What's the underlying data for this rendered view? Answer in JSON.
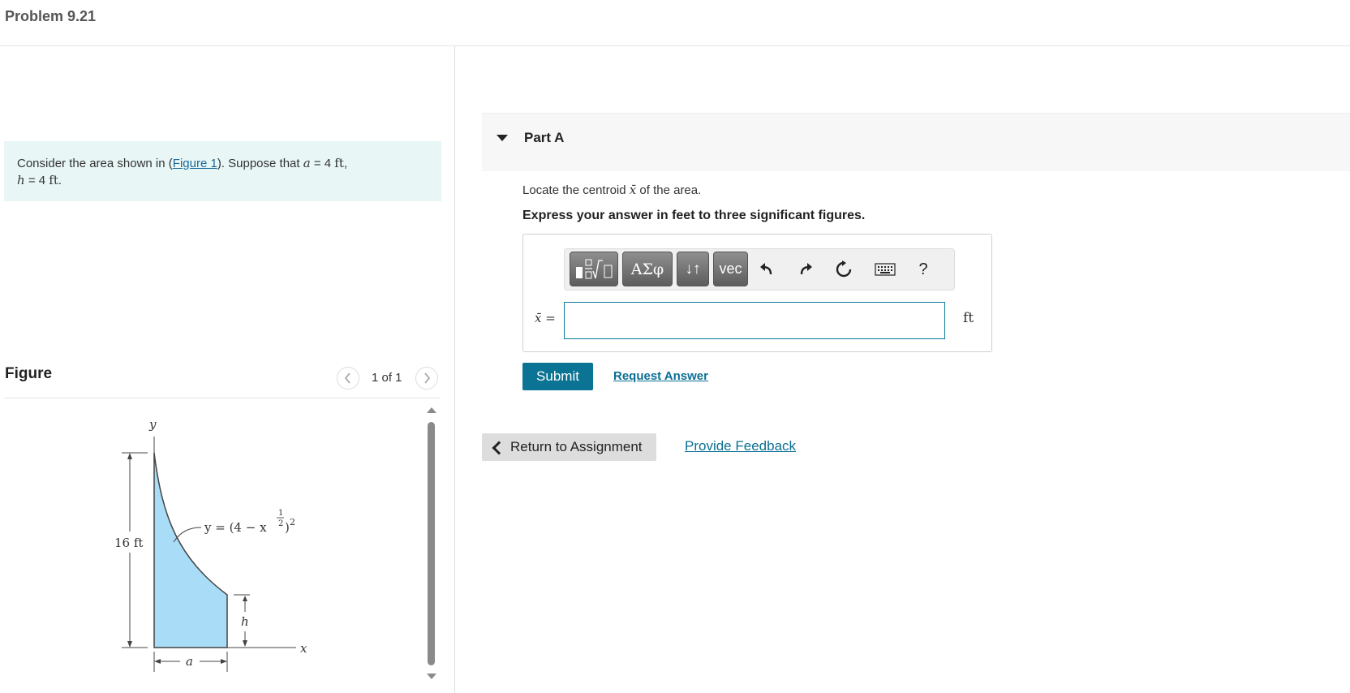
{
  "problem": {
    "title": "Problem 9.21"
  },
  "statement": {
    "prefix": "Consider the area shown in (",
    "figure_link": "Figure 1",
    "middle": "). Suppose that ",
    "var_a": "a",
    "eq_a": " = 4 ",
    "unit_a": "ft",
    "comma": ",",
    "var_h": "h",
    "eq_h": " = 4 ",
    "unit_h": "ft",
    "end": "."
  },
  "figure": {
    "label": "Figure",
    "counter": "1 of 1",
    "prev_icon": "chevron-left-icon",
    "next_icon": "chevron-right-icon",
    "diagram": {
      "axis_y": "y",
      "axis_x": "x",
      "height_label": "16 ft",
      "curve_label_left": "y = (4 − x",
      "curve_exp_inner_num": "1",
      "curve_exp_inner_den": "2",
      "curve_label_right": ")",
      "curve_exp_outer": "2",
      "h_label": "h",
      "a_label": "a"
    }
  },
  "part": {
    "title": "Part A",
    "question_prefix": "Locate the centroid ",
    "question_var": "x̄",
    "question_suffix": " of the area.",
    "instruction": "Express your answer in feet to three significant figures."
  },
  "toolbar": {
    "btn_templates_icon": "fraction-sqrt-icon",
    "btn_greek": "ΑΣφ",
    "btn_arrows": "↓↑",
    "btn_vec": "vec",
    "undo_icon": "undo-icon",
    "redo_icon": "redo-icon",
    "reset_icon": "reset-icon",
    "keyboard_icon": "keyboard-icon",
    "help": "?"
  },
  "answer": {
    "label": "x̄ =",
    "value": "",
    "unit": "ft"
  },
  "actions": {
    "submit": "Submit",
    "request_answer": "Request Answer",
    "return": "Return to Assignment",
    "feedback": "Provide Feedback"
  },
  "colors": {
    "accent": "#0b7394",
    "link": "#0b6f93",
    "problem_bg": "#e8f6f6",
    "area_fill": "#a8dcf7"
  }
}
